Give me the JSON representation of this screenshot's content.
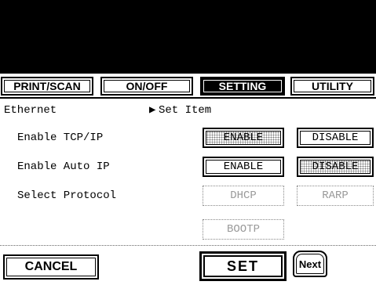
{
  "tabs": [
    {
      "label": "PRINT/SCAN",
      "active": false
    },
    {
      "label": "ON/OFF",
      "active": false
    },
    {
      "label": "SETTING",
      "active": true
    },
    {
      "label": "UTILITY",
      "active": false
    }
  ],
  "breadcrumb": {
    "section": "Ethernet",
    "arrow": "▶",
    "item": "Set Item"
  },
  "rows": {
    "tcpip": {
      "label": "Enable TCP/IP",
      "enable": "ENABLE",
      "disable": "DISABLE",
      "selected": "enable"
    },
    "autoip": {
      "label": "Enable Auto IP",
      "enable": "ENABLE",
      "disable": "DISABLE",
      "selected": "disable"
    },
    "protocol": {
      "label": "Select Protocol",
      "options": [
        "DHCP",
        "RARP",
        "BOOTP"
      ],
      "enabled": false
    }
  },
  "footer": {
    "cancel": "CANCEL",
    "set": "SET",
    "next": "Next"
  }
}
